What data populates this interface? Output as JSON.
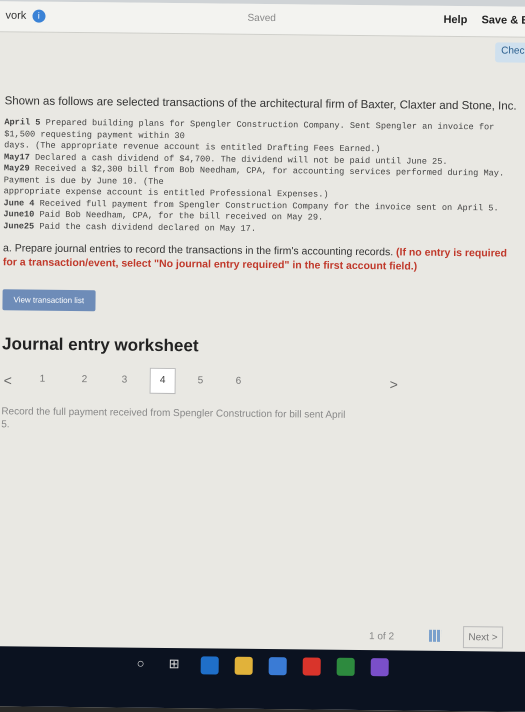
{
  "header": {
    "brand": "vork",
    "badge": "i",
    "saved": "Saved",
    "help": "Help",
    "save_exit": "Save & E",
    "check": "Chec"
  },
  "problem": {
    "intro": "Shown as follows are selected transactions of the architectural firm of Baxter, Claxter and Stone, Inc.",
    "transactions": [
      {
        "date": "April 5",
        "text": "Prepared building plans for Spengler Construction Company. Sent Spengler an invoice for $1,500 requesting payment within 30"
      },
      {
        "date": "",
        "text": "     days. (The appropriate revenue account is entitled Drafting Fees Earned.)"
      },
      {
        "date": "May17",
        "text": "Declared a cash dividend of $4,700. The dividend will not be paid until June 25."
      },
      {
        "date": "May29",
        "text": "Received a $2,300 bill from Bob Needham, CPA, for accounting services performed during May. Payment is due by June 10. (The"
      },
      {
        "date": "",
        "text": "     appropriate expense account is entitled Professional Expenses.)"
      },
      {
        "date": "June 4",
        "text": "Received full payment from Spengler Construction Company for the invoice sent on April 5."
      },
      {
        "date": "June10",
        "text": "Paid Bob Needham, CPA, for the bill received on May 29."
      },
      {
        "date": "June25",
        "text": "Paid the cash dividend declared on May 17."
      }
    ],
    "instruction_main": "a. Prepare journal entries to record the transactions in the firm's accounting records. ",
    "instruction_red": "(If no entry is required for a transaction/event, select \"No journal entry required\" in the first account field.)"
  },
  "worksheet": {
    "view_button": "View transaction list",
    "title": "Journal entry worksheet",
    "prev": "<",
    "next": ">",
    "pages": [
      "1",
      "2",
      "3",
      "4",
      "5",
      "6"
    ],
    "current_page": "4",
    "record_text": "Record the full payment received from Spengler Construction for bill sent April",
    "record_num": "5."
  },
  "footer": {
    "page_indicator": "1 of 2",
    "next_button": "Next >"
  }
}
